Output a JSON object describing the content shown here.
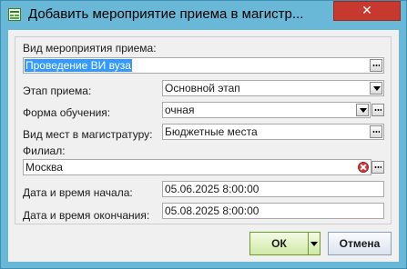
{
  "window": {
    "title": "Добавить мероприятие приема в магистр...",
    "close_glyph": "✕"
  },
  "form": {
    "event_type": {
      "label": "Вид мероприятия приема:",
      "value": "Проведение ВИ вуза"
    },
    "stage": {
      "label": "Этап приема:",
      "value": "Основной этап"
    },
    "study_form": {
      "label": "Форма обучения:",
      "value": "очная"
    },
    "places_type": {
      "label": "Вид мест в магистратуру:",
      "value": "Бюджетные места"
    },
    "branch": {
      "label": "Филиал:",
      "value": "Москва"
    },
    "start_datetime": {
      "label": "Дата и время начала:",
      "value": "05.06.2025 8:00:00"
    },
    "end_datetime": {
      "label": "Дата и время окончания:",
      "value": "05.08.2025 8:00:00"
    }
  },
  "buttons": {
    "ok": "ОК",
    "cancel": "Отмена"
  },
  "icons": {
    "app": "app-window-icon",
    "browse": "ellipsis-icon",
    "dropdown": "chevron-down-icon",
    "clear": "clear-icon"
  },
  "colors": {
    "titlebar": "#6ab8d8",
    "close": "#c7392f",
    "selection": "#3399ff",
    "ok_button": "#cfe9a6"
  }
}
